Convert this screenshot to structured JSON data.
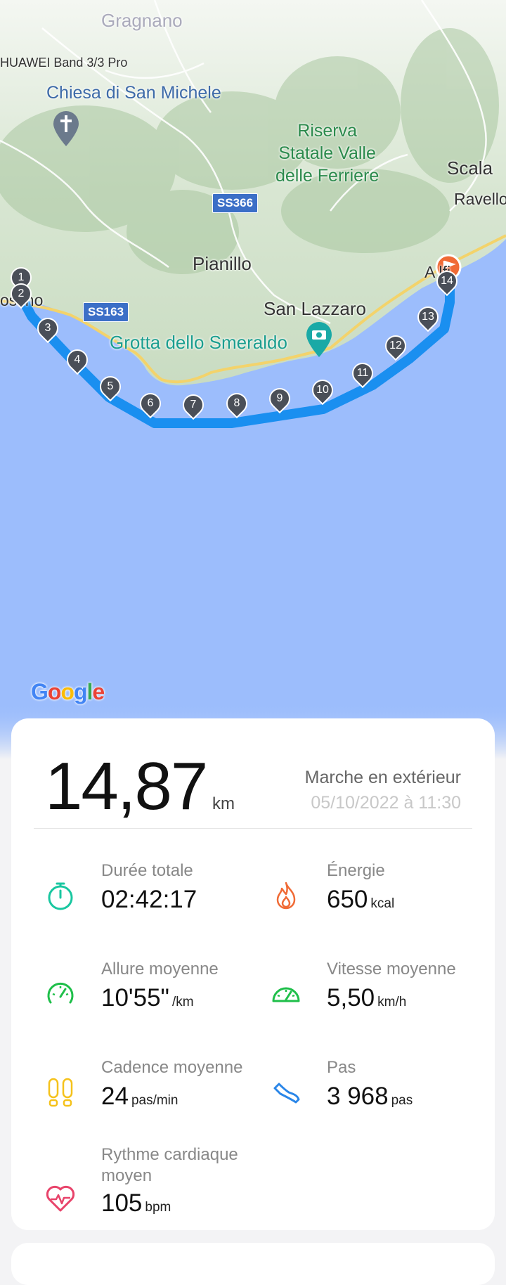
{
  "map": {
    "labels": {
      "gragnano": "Gragnano",
      "device": "HUAWEI Band 3/3 Pro",
      "chiesa": "Chiesa di San Michele",
      "riserva": "Riserva\nStatale Valle\ndelle Ferriere",
      "scala": "Scala",
      "ravello": "Ravello",
      "pianillo": "Pianillo",
      "san_lazzaro": "San Lazzaro",
      "grotta": "Grotta dello Smeraldo",
      "positano": "osi  no",
      "amalfi": "A    lfi"
    },
    "roads": {
      "ss366": "SS366",
      "ss163": "SS163"
    },
    "markers": [
      "1",
      "2",
      "3",
      "4",
      "5",
      "6",
      "7",
      "8",
      "9",
      "10",
      "11",
      "12",
      "13",
      "14"
    ],
    "google": "Google",
    "colors": {
      "water": "#9cbdfc",
      "route": "#1a8ff0"
    }
  },
  "summary": {
    "distance": "14,87",
    "distance_unit": "km",
    "activity": "Marche en extérieur",
    "date": "05/10/2022 à 11:30"
  },
  "stats": {
    "duration": {
      "label": "Durée totale",
      "value": "02:42:17",
      "unit": "",
      "icon": "stopwatch-icon"
    },
    "energy": {
      "label": "Énergie",
      "value": "650",
      "unit": "kcal",
      "icon": "flame-icon"
    },
    "pace": {
      "label": "Allure moyenne",
      "value": "10'55\"",
      "unit": "/km",
      "icon": "speedometer-icon"
    },
    "speed": {
      "label": "Vitesse moyenne",
      "value": "5,50",
      "unit": "km/h",
      "icon": "gauge-icon"
    },
    "cadence": {
      "label": "Cadence moyenne",
      "value": "24",
      "unit": "pas/min",
      "icon": "footprints-icon"
    },
    "steps": {
      "label": "Pas",
      "value": "3 968",
      "unit": "pas",
      "icon": "shoe-icon"
    },
    "heart": {
      "label": "Rythme cardiaque\nmoyen",
      "value": "105",
      "unit": "bpm",
      "icon": "heart-rate-icon"
    }
  }
}
